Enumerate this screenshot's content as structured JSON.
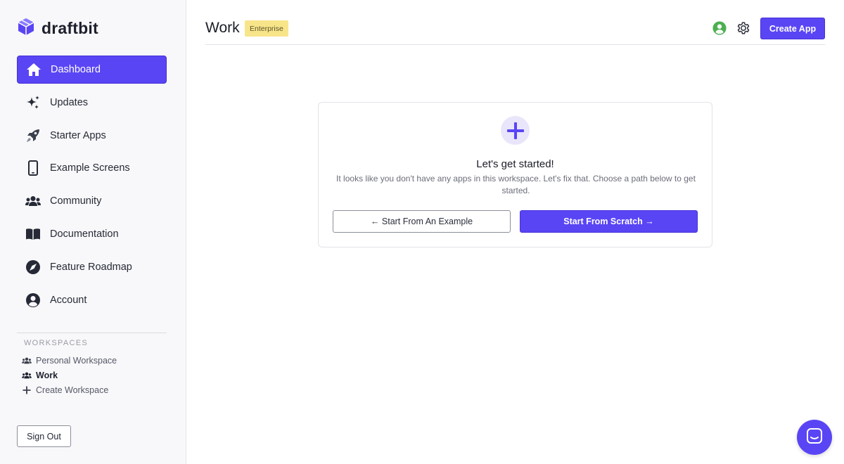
{
  "brand": {
    "name": "draftbit"
  },
  "sidebar": {
    "items": [
      {
        "label": "Dashboard",
        "icon": "home-icon",
        "active": true
      },
      {
        "label": "Updates",
        "icon": "sparkles-icon",
        "active": false
      },
      {
        "label": "Starter Apps",
        "icon": "rocket-icon",
        "active": false
      },
      {
        "label": "Example Screens",
        "icon": "phone-icon",
        "active": false
      },
      {
        "label": "Community",
        "icon": "users-icon",
        "active": false
      },
      {
        "label": "Documentation",
        "icon": "book-icon",
        "active": false
      },
      {
        "label": "Feature Roadmap",
        "icon": "compass-icon",
        "active": false
      },
      {
        "label": "Account",
        "icon": "user-circle-icon",
        "active": false
      }
    ],
    "workspaces_title": "WORKSPACES",
    "workspaces": [
      {
        "label": "Personal Workspace",
        "icon": "users-icon",
        "current": false
      },
      {
        "label": "Work",
        "icon": "users-icon",
        "current": true
      },
      {
        "label": "Create Workspace",
        "icon": "plus-icon",
        "current": false
      }
    ],
    "sign_out_label": "Sign Out"
  },
  "header": {
    "title": "Work",
    "badge": "Enterprise",
    "create_label": "Create App"
  },
  "empty_state": {
    "title": "Let's get started!",
    "description": "It looks like you don't have any apps in this workspace. Let's fix that. Choose a path below to get started.",
    "example_label": "← Start From An Example",
    "scratch_label": "Start From Scratch →"
  },
  "colors": {
    "accent": "#5a45f5",
    "badge_bg": "#f8e58a",
    "status_green": "#4caf50"
  }
}
